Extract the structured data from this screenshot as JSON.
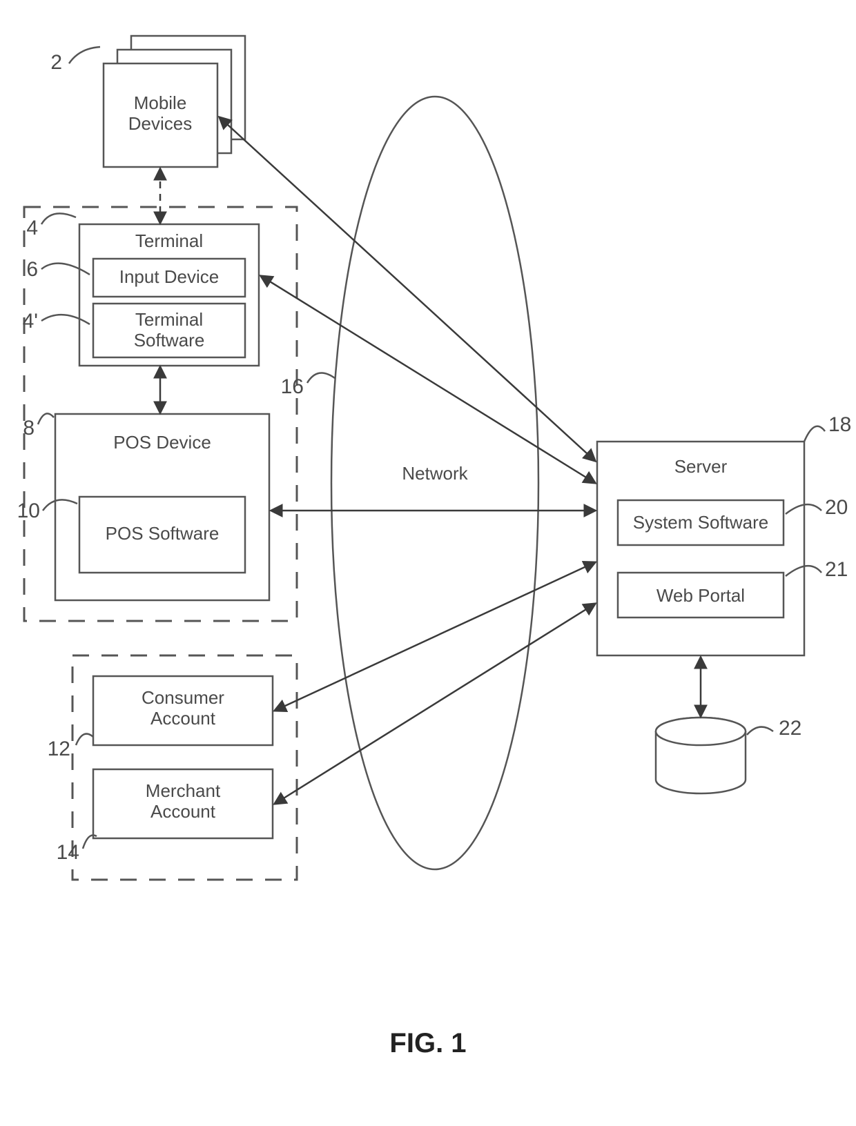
{
  "figure_title": "FIG. 1",
  "network_label": "Network",
  "blocks": {
    "mobile_devices": "Mobile Devices",
    "terminal": "Terminal",
    "input_device": "Input Device",
    "terminal_software": "Terminal Software",
    "pos_device": "POS Device",
    "pos_software": "POS Software",
    "consumer_account": "Consumer Account",
    "merchant_account": "Merchant Account",
    "server": "Server",
    "system_software": "System Software",
    "web_portal": "Web Portal"
  },
  "refs": {
    "2": "2",
    "4": "4",
    "4p": "4'",
    "6": "6",
    "8": "8",
    "10": "10",
    "12": "12",
    "14": "14",
    "16": "16",
    "18": "18",
    "20": "20",
    "21": "21",
    "22": "22"
  }
}
